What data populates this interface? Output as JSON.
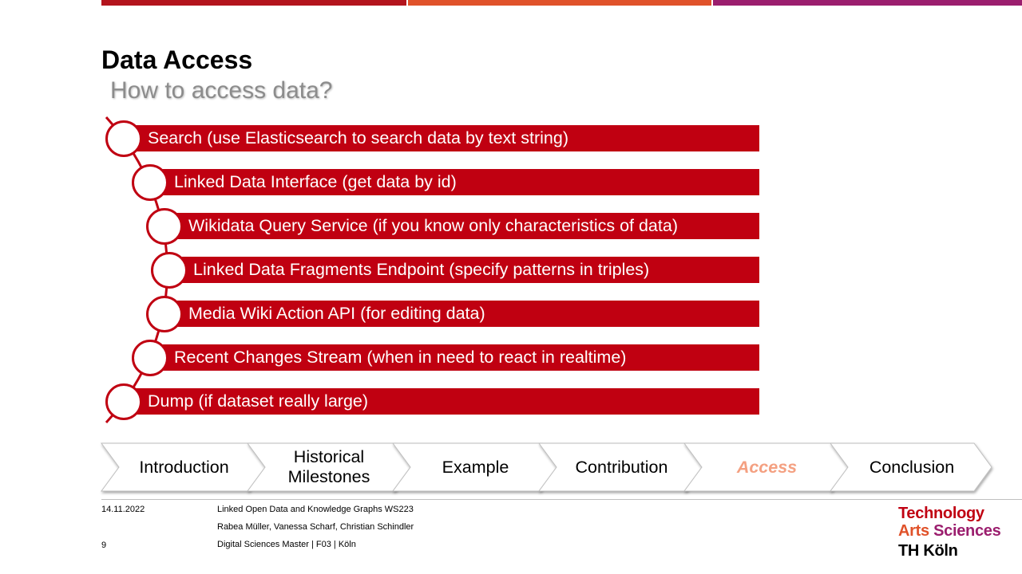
{
  "colors": {
    "accent": "#c00011",
    "bar_orange": "#e0522a",
    "bar_purple": "#9b1e6e",
    "active_tab": "#f4a081"
  },
  "slide": {
    "title": "Data Access",
    "subtitle": "How to access data?"
  },
  "methods": [
    {
      "label": "Search (use Elasticsearch to search data by text string)"
    },
    {
      "label": "Linked Data Interface (get data by id)"
    },
    {
      "label": "Wikidata Query Service (if you know only characteristics of data)"
    },
    {
      "label": "Linked Data Fragments Endpoint (specify patterns in triples)"
    },
    {
      "label": "Media Wiki Action API (for editing data)"
    },
    {
      "label": "Recent Changes Stream (when in need to react in realtime)"
    },
    {
      "label": "Dump (if dataset really large)"
    }
  ],
  "navigation": {
    "steps": [
      {
        "label": "Introduction"
      },
      {
        "label": "Historical Milestones"
      },
      {
        "label": "Example"
      },
      {
        "label": "Contribution"
      },
      {
        "label": "Access"
      },
      {
        "label": "Conclusion"
      }
    ],
    "active": "Access"
  },
  "footer": {
    "date": "14.11.2022",
    "page_number": "9",
    "course": "Linked Open Data and Knowledge Graphs WS223",
    "authors": "Rabea Müller, Vanessa Scharf, Christian Schindler",
    "program": "Digital Sciences Master | F03 | Köln"
  },
  "logo": {
    "line1": "Technology",
    "line2a": "Arts",
    "line2b": "Sciences",
    "line3": "TH Köln"
  }
}
